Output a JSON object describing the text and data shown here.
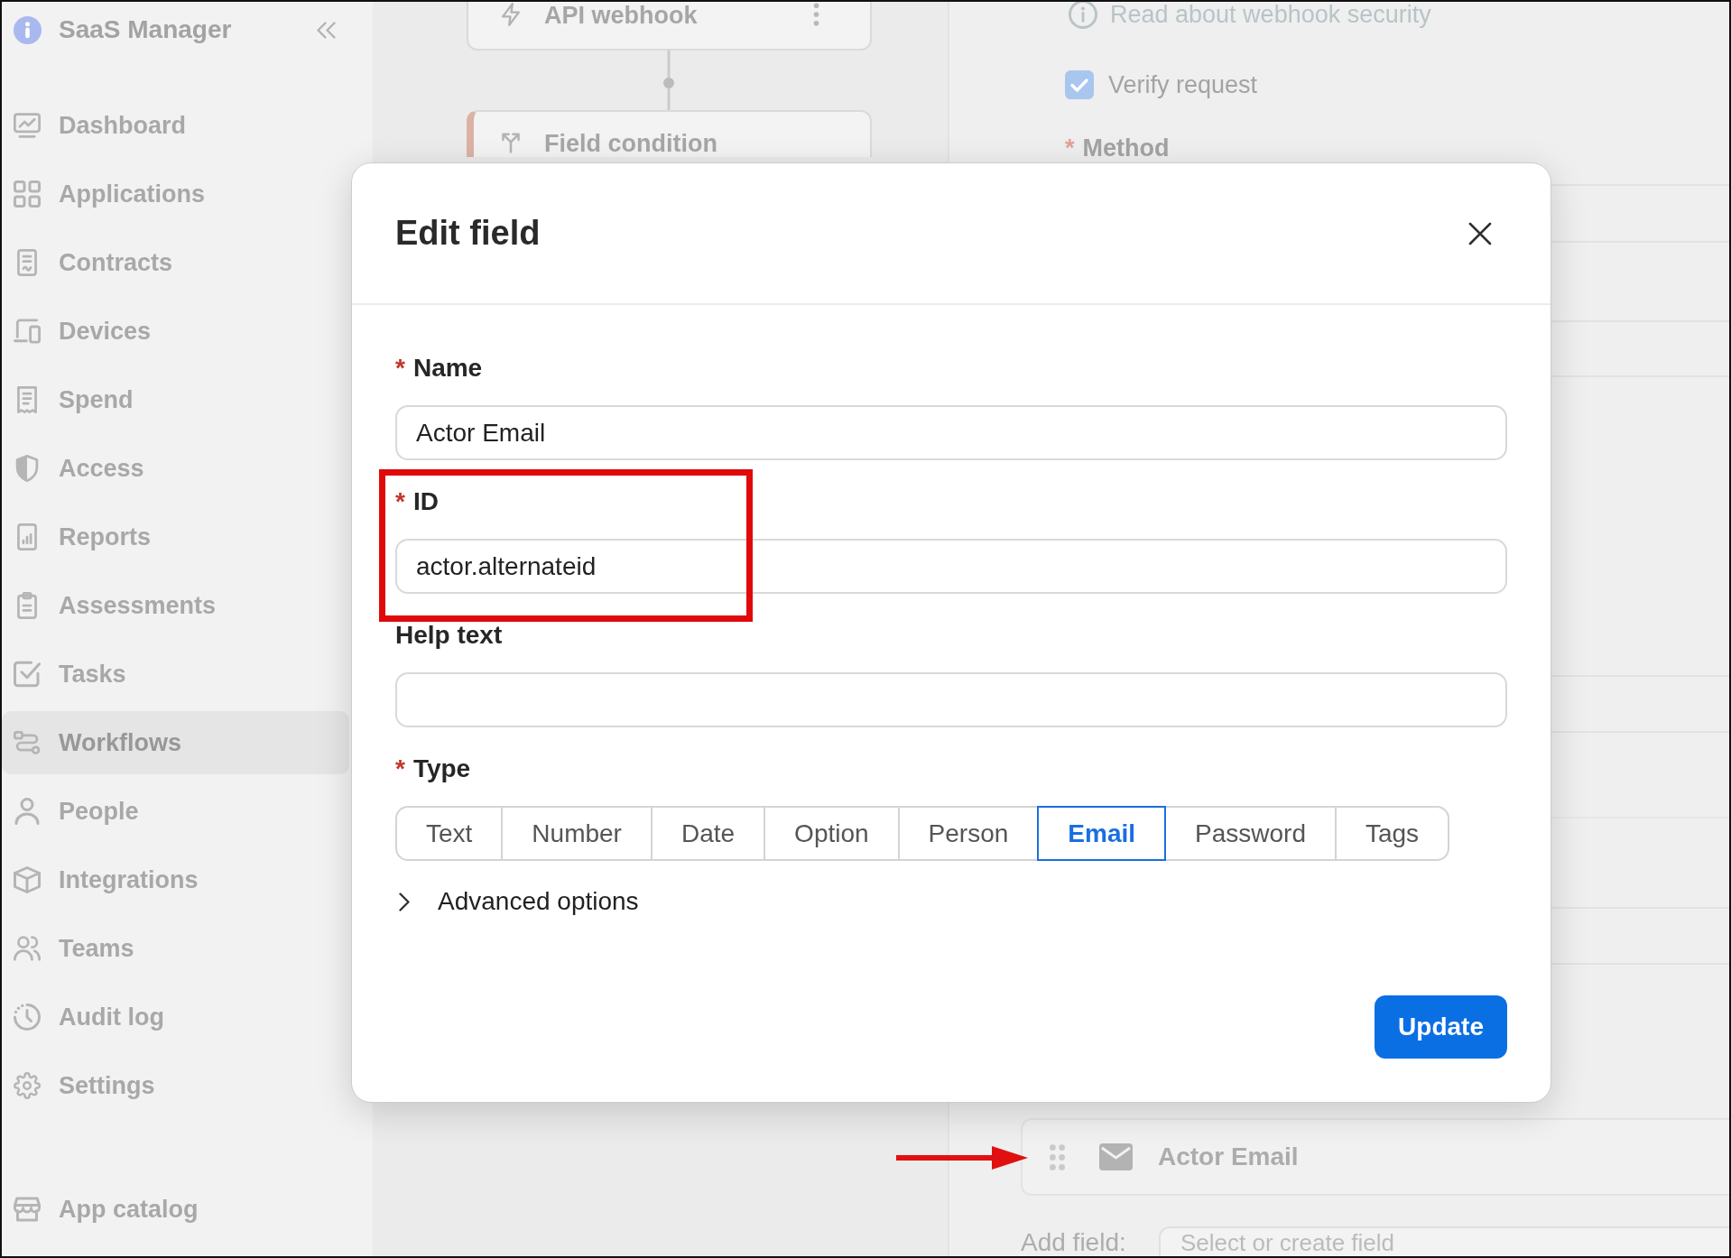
{
  "sidebar": {
    "title": "SaaS Manager",
    "items": [
      {
        "label": "Dashboard",
        "selected": false
      },
      {
        "label": "Applications",
        "selected": false
      },
      {
        "label": "Contracts",
        "selected": false
      },
      {
        "label": "Devices",
        "selected": false
      },
      {
        "label": "Spend",
        "selected": false
      },
      {
        "label": "Access",
        "selected": false
      },
      {
        "label": "Reports",
        "selected": false
      },
      {
        "label": "Assessments",
        "selected": false
      },
      {
        "label": "Tasks",
        "selected": false
      },
      {
        "label": "Workflows",
        "selected": true
      },
      {
        "label": "People",
        "selected": false
      },
      {
        "label": "Integrations",
        "selected": false
      },
      {
        "label": "Teams",
        "selected": false
      },
      {
        "label": "Audit log",
        "selected": false
      },
      {
        "label": "Settings",
        "selected": false
      }
    ],
    "footer_items": [
      {
        "label": "App catalog",
        "selected": false
      }
    ]
  },
  "canvas": {
    "nodes": [
      {
        "kind": "trigger",
        "label": "API webhook"
      },
      {
        "kind": "condition",
        "label": "Field condition"
      }
    ]
  },
  "settings_panel": {
    "link": "Read about webhook security",
    "verify_request": {
      "label": "Verify request",
      "checked": true
    },
    "method": {
      "mark": "*",
      "label": "Method"
    },
    "fields": [
      {
        "kind": "email",
        "label": "Actor Email"
      }
    ],
    "add_field": {
      "label": "Add field:",
      "placeholder": "Select or create field"
    }
  },
  "dialog": {
    "title": "Edit field",
    "inputs": [
      {
        "mark": "*",
        "label": "Name",
        "value": "Actor Email"
      },
      {
        "mark": "*",
        "label": "ID",
        "value": "actor.alternateid"
      },
      {
        "label": "Help text"
      }
    ],
    "type": {
      "mark": "*",
      "label": "Type",
      "options": [
        {
          "label": "Text",
          "selected": false
        },
        {
          "label": "Number",
          "selected": false
        },
        {
          "label": "Date",
          "selected": false
        },
        {
          "label": "Option",
          "selected": false
        },
        {
          "label": "Person",
          "selected": false
        },
        {
          "label": "Email",
          "selected": true
        },
        {
          "label": "Password",
          "selected": false
        },
        {
          "label": "Tags",
          "selected": false
        }
      ]
    },
    "advanced": {
      "label": "Advanced options",
      "expanded": false
    },
    "buttons": [
      {
        "kind": "primary",
        "label": "Update"
      }
    ]
  }
}
